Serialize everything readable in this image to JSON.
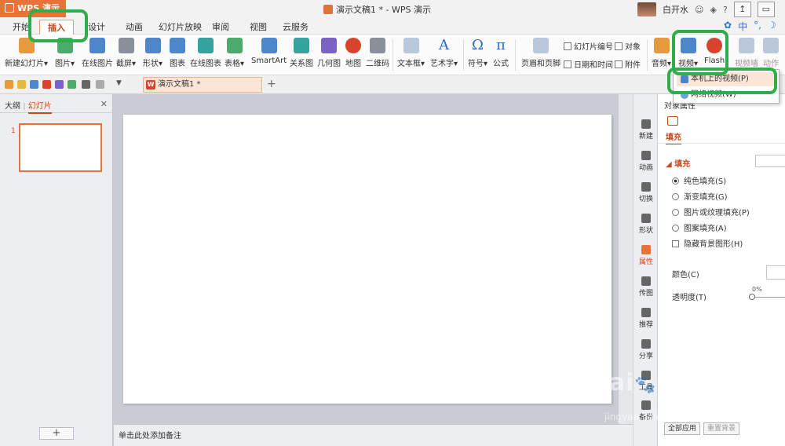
{
  "titlebar": {
    "app_name": "WPS 演示",
    "window_title": "演示文稿1 * - WPS 演示",
    "user_name": "白开水",
    "help_icon": "?",
    "icons": [
      "avatar",
      "smiley-icon",
      "skin-icon",
      "help-icon",
      "restore-icon",
      "minimize-icon"
    ]
  },
  "menu": {
    "tabs": [
      "开始",
      "插入",
      "设计",
      "动画",
      "幻灯片放映",
      "审阅",
      "视图",
      "云服务"
    ],
    "active_tab": "插入",
    "right_glyphs": [
      "中",
      "°,",
      "☽"
    ]
  },
  "ribbon": {
    "new_slide": "新建幻灯片",
    "picture": "图片",
    "online_picture": "在线图片",
    "screenshot": "截屏",
    "shape": "形状",
    "chart": "图表",
    "online_chart": "在线图表",
    "table": "表格",
    "smartart": "SmartArt",
    "relation": "关系图",
    "geometry": "几何图",
    "map": "地图",
    "qrcode": "二维码",
    "textbox": "文本框",
    "art_text": "艺术字",
    "symbol": "符号",
    "symbol_glyph": "Ω",
    "formula": "公式",
    "formula_glyph": "π",
    "header_footer": "页眉和页脚",
    "slide_number": "幻灯片编号",
    "object": "对象",
    "date_time": "日期和时间",
    "attachment": "附件",
    "audio": "音频",
    "video": "视频",
    "flash": "Flash",
    "screen_record": "视频墙",
    "more": "动作"
  },
  "video_dropdown": {
    "items": [
      "本机上的视频(P)",
      "网络视频(W)"
    ],
    "highlighted": "本机上的视频(P)"
  },
  "quickbar": {
    "doc_tab": "演示文稿1 *",
    "doc_tab_icon": "W",
    "new_tab": "+"
  },
  "left_panel": {
    "tab_outline": "大纲",
    "tab_slides": "幻灯片",
    "close": "✕",
    "slide_number": "1",
    "add_button": "+"
  },
  "notes": {
    "placeholder": "单击此处添加备注"
  },
  "right_strip": {
    "items": [
      "新建",
      "动画",
      "切换",
      "形状",
      "属性",
      "传图",
      "推荐",
      "分享",
      "工具",
      "备份"
    ]
  },
  "properties": {
    "title": "对象属性",
    "tab": "填充",
    "section": "填充",
    "options": [
      "纯色填充(S)",
      "渐变填充(G)",
      "图片或纹理填充(P)",
      "图案填充(A)"
    ],
    "selected_option": "纯色填充(S)",
    "hide_bg": "隐藏背景图形(H)",
    "color_label": "颜色(C)",
    "transparency_label": "透明度(T)",
    "transparency_value": "0%",
    "apply_all": "全部应用",
    "reset_bg": "重置背景"
  },
  "watermark": {
    "main": "Bai 经验",
    "sub": "jingyan.baidu.com"
  },
  "colors": {
    "accent": "#e8733a",
    "highlight": "#2fad4a",
    "active_tab_text": "#c9491b"
  }
}
